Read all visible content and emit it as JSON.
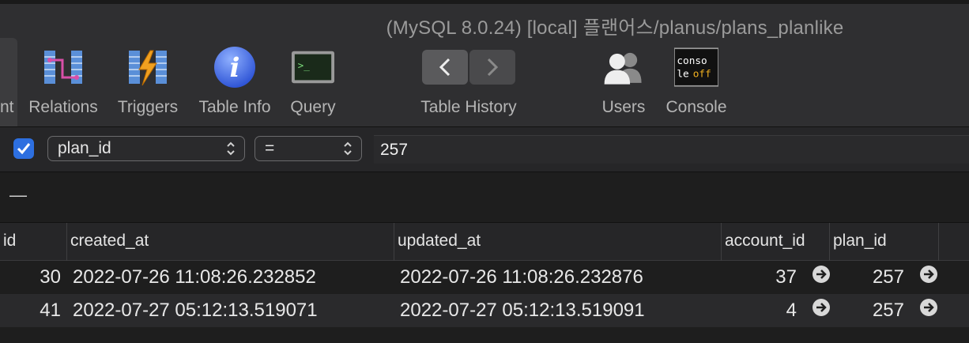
{
  "window": {
    "title": "(MySQL 8.0.24) [local] 플랜어스/planus/plans_planlike"
  },
  "toolbar": {
    "partial_label": "nt",
    "items": [
      {
        "label": "Relations",
        "icon": "relations-icon"
      },
      {
        "label": "Triggers",
        "icon": "triggers-icon"
      },
      {
        "label": "Table Info",
        "icon": "info-icon"
      },
      {
        "label": "Query",
        "icon": "terminal-icon"
      },
      {
        "label": "Table History",
        "icon": "history-icon"
      },
      {
        "label": "Users",
        "icon": "users-icon"
      },
      {
        "label": "Console",
        "icon": "console-icon"
      }
    ],
    "console_icon_text": [
      "conso",
      "le",
      "off"
    ]
  },
  "filter": {
    "enabled": true,
    "field": "plan_id",
    "operator": "=",
    "value": "257"
  },
  "rows_toolbar": {
    "remove_label": "—"
  },
  "table": {
    "columns": [
      "id",
      "created_at",
      "updated_at",
      "account_id",
      "plan_id"
    ],
    "rows": [
      {
        "id": "30",
        "created_at": "2022-07-26 11:08:26.232852",
        "updated_at": "2022-07-26 11:08:26.232876",
        "account_id": "37",
        "plan_id": "257"
      },
      {
        "id": "41",
        "created_at": "2022-07-27 05:12:13.519071",
        "updated_at": "2022-07-27 05:12:13.519091",
        "account_id": "4",
        "plan_id": "257"
      }
    ]
  },
  "colors": {
    "accent": "#2d6fe0",
    "background": "#1e1e1e",
    "toolbar": "#2f2f31"
  }
}
